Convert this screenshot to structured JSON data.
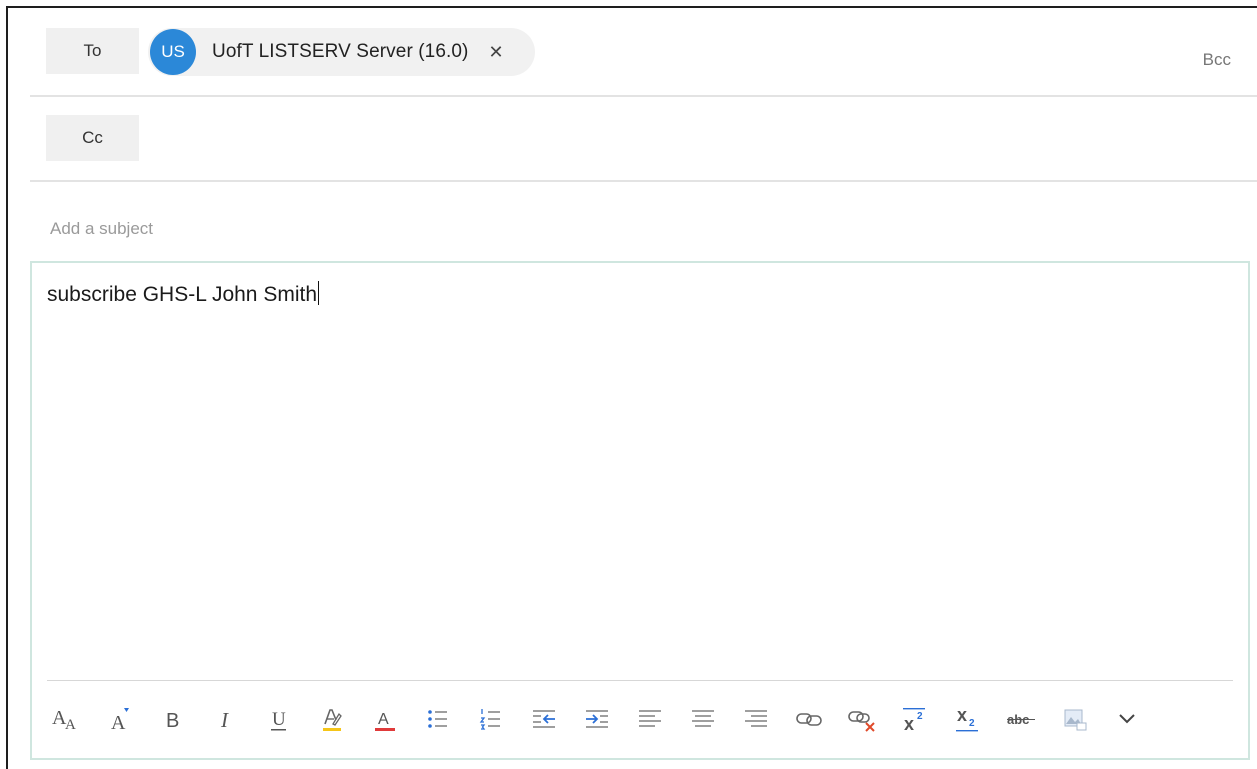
{
  "compose": {
    "to_label": "To",
    "cc_label": "Cc",
    "bcc_label": "Bcc",
    "recipient": {
      "initials": "US",
      "name": "UofT LISTSERV Server (16.0)",
      "remove_glyph": "✕",
      "avatar_color": "#2b88d8"
    },
    "subject_placeholder": "Add a subject",
    "body_text": "subscribe GHS-L John Smith"
  },
  "toolbar": {
    "buttons": [
      "font-size-icon",
      "grow-font-icon",
      "bold-icon",
      "italic-icon",
      "underline-icon",
      "highlight-icon",
      "font-color-icon",
      "bullets-icon",
      "numbering-icon",
      "outdent-icon",
      "indent-icon",
      "align-left-icon",
      "align-center-icon",
      "align-right-icon",
      "link-icon",
      "remove-link-icon",
      "superscript-icon",
      "subscript-icon",
      "strikethrough-icon",
      "image-icon",
      "more-options-icon"
    ],
    "labels": {
      "font_size_big": "A",
      "font_size_small": "A",
      "grow_font": "A",
      "bold": "B",
      "italic": "I",
      "underline": "U",
      "font_color": "A",
      "superscript": "x",
      "superscript_num": "2",
      "subscript": "x",
      "subscript_num": "2",
      "strikethrough": "abc"
    },
    "colors": {
      "accent": "#2b6fd6",
      "highlight": "#f5c518",
      "font_color": "#e03a3a",
      "remove": "#e04a2a"
    }
  }
}
